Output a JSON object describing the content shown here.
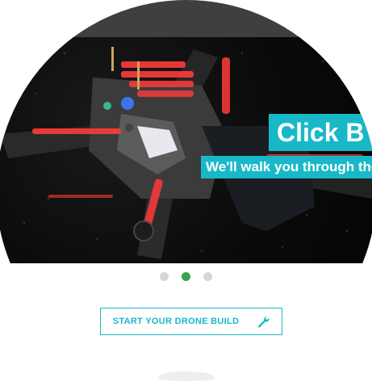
{
  "hero": {
    "image_alt": "racing drone with red LED lights",
    "title": "Click B",
    "subtitle": "We'll walk you through the"
  },
  "carousel": {
    "slides": [
      "slide-1",
      "slide-2",
      "slide-3"
    ],
    "active_index": 1
  },
  "cta": {
    "label": "START YOUR DRONE BUILD",
    "icon": "wrench-icon"
  },
  "colors": {
    "accent": "#19b8c8",
    "active_dot": "#3aa34a",
    "inactive_dot": "#d6d6d6",
    "topbar": "#3f3f3f"
  }
}
